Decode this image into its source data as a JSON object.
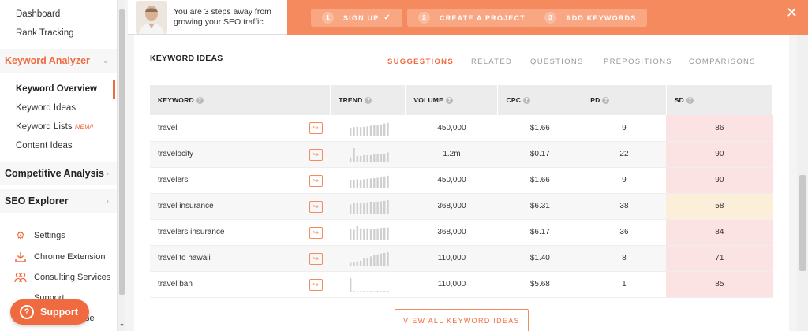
{
  "sidebar": {
    "top_items": [
      "Dashboard",
      "Rank Tracking"
    ],
    "keyword_analyzer": "Keyword Analyzer",
    "sub_items": [
      "Keyword Overview",
      "Keyword Ideas",
      "Keyword Lists",
      "Content Ideas"
    ],
    "new_badge": "NEW!",
    "competitive_analysis": "Competitive Analysis",
    "seo_explorer": "SEO Explorer",
    "settings": "Settings",
    "chrome_extension": "Chrome Extension",
    "consulting_services": "Consulting Services",
    "support_hidden": "Support",
    "knowledge_base_fragment": "se",
    "support_button": "Support"
  },
  "banner": {
    "text": "You are 3 steps away from growing your SEO traffic",
    "steps": [
      {
        "num": "1",
        "label": "SIGN UP",
        "done": true
      },
      {
        "num": "2",
        "label": "CREATE A PROJECT",
        "done": false
      },
      {
        "num": "3",
        "label": "ADD KEYWORDS",
        "done": false
      }
    ],
    "close": "✕"
  },
  "main": {
    "title": "KEYWORD IDEAS",
    "tabs": [
      "SUGGESTIONS",
      "RELATED",
      "QUESTIONS",
      "PREPOSITIONS",
      "COMPARISONS"
    ],
    "active_tab": "SUGGESTIONS",
    "columns": [
      "KEYWORD",
      "TREND",
      "VOLUME",
      "CPC",
      "PD",
      "SD"
    ],
    "rows": [
      {
        "keyword": "travel",
        "volume": "450,000",
        "cpc": "$1.66",
        "pd": "9",
        "sd": "86",
        "trend": [
          0.55,
          0.6,
          0.62,
          0.6,
          0.62,
          0.65,
          0.7,
          0.72,
          0.75,
          0.78,
          0.85,
          0.9
        ]
      },
      {
        "keyword": "travelocity",
        "volume": "1.2m",
        "cpc": "$0.17",
        "pd": "22",
        "sd": "90",
        "trend": [
          0.35,
          1.0,
          0.45,
          0.45,
          0.5,
          0.5,
          0.5,
          0.55,
          0.6,
          0.6,
          0.62,
          0.7
        ]
      },
      {
        "keyword": "travelers",
        "volume": "450,000",
        "cpc": "$1.66",
        "pd": "9",
        "sd": "90",
        "trend": [
          0.6,
          0.62,
          0.65,
          0.62,
          0.65,
          0.68,
          0.7,
          0.72,
          0.75,
          0.8,
          0.85,
          0.9
        ]
      },
      {
        "keyword": "travel insurance",
        "volume": "368,000",
        "cpc": "$6.31",
        "pd": "38",
        "sd": "58",
        "trend": [
          0.7,
          0.8,
          0.85,
          0.8,
          0.82,
          0.85,
          0.9,
          0.88,
          0.9,
          0.92,
          0.95,
          1.0
        ]
      },
      {
        "keyword": "travelers insurance",
        "volume": "368,000",
        "cpc": "$6.17",
        "pd": "36",
        "sd": "84",
        "trend": [
          0.8,
          0.75,
          1.0,
          0.85,
          0.8,
          0.85,
          0.8,
          0.82,
          0.85,
          0.88,
          0.9,
          0.92
        ]
      },
      {
        "keyword": "travel to hawaii",
        "volume": "110,000",
        "cpc": "$1.40",
        "pd": "8",
        "sd": "71",
        "trend": [
          0.25,
          0.3,
          0.35,
          0.4,
          0.55,
          0.6,
          0.7,
          0.8,
          0.85,
          0.9,
          0.95,
          1.0
        ]
      },
      {
        "keyword": "travel ban",
        "volume": "110,000",
        "cpc": "$5.68",
        "pd": "1",
        "sd": "85",
        "trend": [
          1.0,
          0.1,
          0.08,
          0.08,
          0.1,
          0.08,
          0.1,
          0.08,
          0.1,
          0.08,
          0.1,
          0.1
        ]
      }
    ],
    "view_all": "VIEW ALL KEYWORD IDEAS"
  },
  "colors": {
    "accent": "#f06a3f",
    "banner": "#f58a5f",
    "sd_hard": "#fbe3e3",
    "sd_medium": "#fcefd9"
  }
}
